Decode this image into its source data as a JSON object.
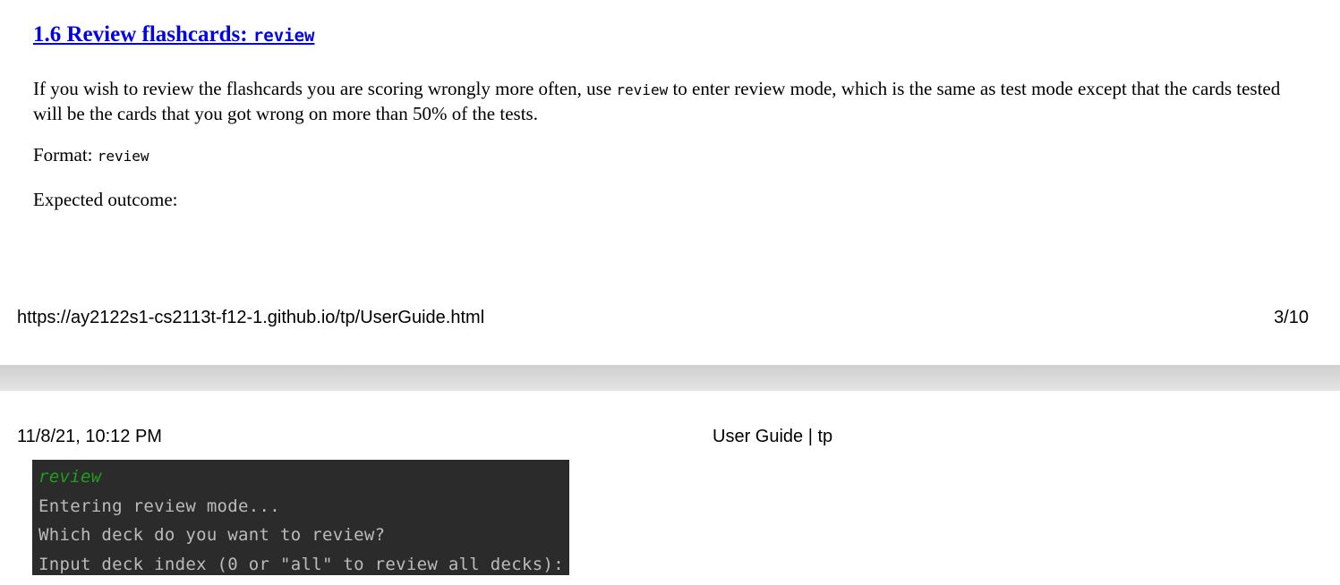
{
  "section": {
    "title_prefix": "1.6 Review flashcards: ",
    "title_code": "review"
  },
  "intro": {
    "text_before": "If you wish to review the flashcards you are scoring wrongly more often, use ",
    "code": "review",
    "text_after": " to enter review mode, which is the same as test mode except that the cards tested will be the cards that you got wrong on more than 50% of the tests."
  },
  "format": {
    "label": "Format: ",
    "code": "review"
  },
  "expected_outcome": "Expected outcome:",
  "footer": {
    "url": "https://ay2122s1-cs2113t-f12-1.github.io/tp/UserGuide.html",
    "page": "3/10"
  },
  "header": {
    "datetime": "11/8/21, 10:12 PM",
    "title": "User Guide | tp"
  },
  "terminal": {
    "lines": [
      "review",
      "Entering review mode...",
      "Which deck do you want to review?",
      "Input deck index (0 or \"all\" to review all decks):"
    ]
  },
  "colors": {
    "link": "#0000ee",
    "terminal_bg": "#2b2b2b",
    "terminal_text": "#bbbbbb",
    "terminal_command": "#1f9e1f"
  }
}
